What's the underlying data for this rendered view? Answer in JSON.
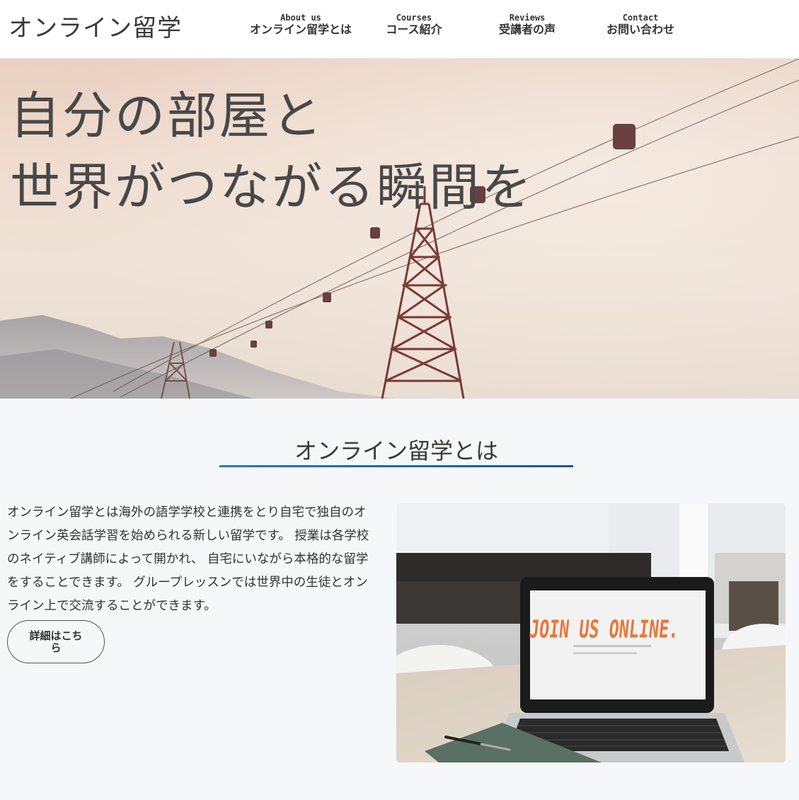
{
  "header": {
    "logo": "オンライン留学",
    "nav": [
      {
        "en": "About us",
        "ja": "オンライン留学とは"
      },
      {
        "en": "Courses",
        "ja": "コース紹介"
      },
      {
        "en": "Reviews",
        "ja": "受講者の声"
      },
      {
        "en": "Contact",
        "ja": "お問い合わせ"
      }
    ]
  },
  "hero": {
    "line1": "自分の部屋と",
    "line2": "世界がつながる瞬間を"
  },
  "about": {
    "title": "オンライン留学とは",
    "text": "オンライン留学とは海外の語学学校と連携をとり自宅で独自のオンライン英会話学習を始められる新しい留学です。 授業は各学校のネイティブ講師によって開かれ、 自宅にいながら本格的な留学をすることできます。 グループレッスンでは世界中の生徒とオンライン上で交流することができます。",
    "button": "詳細はこちら",
    "image_caption": "JOIN US ONLINE."
  },
  "colors": {
    "accent": "#1f7ad3",
    "accent_dark": "#0b57b0",
    "laptop_text": "#e8773a"
  }
}
